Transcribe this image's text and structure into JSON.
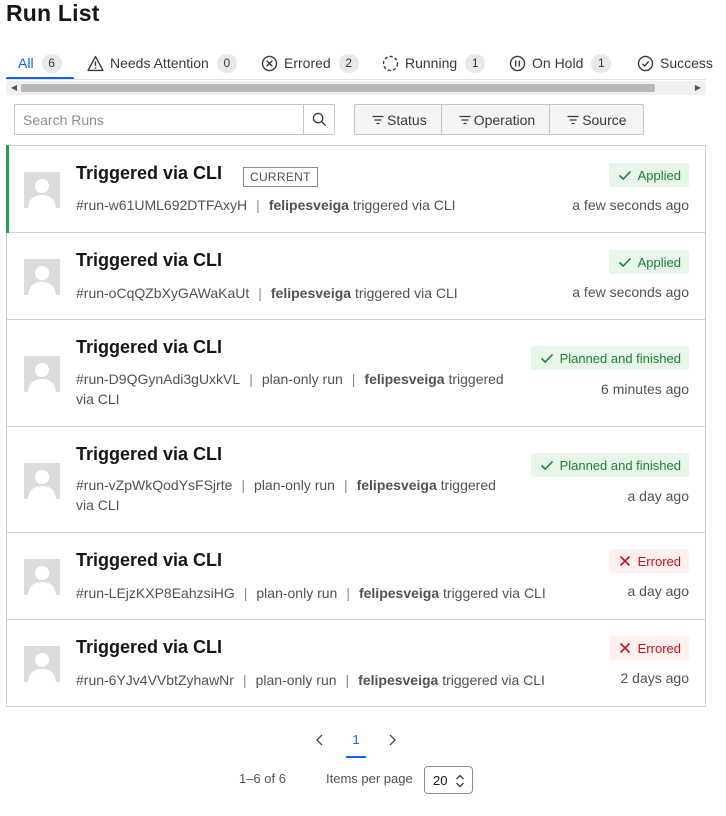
{
  "page": {
    "title": "Run List"
  },
  "tabs": [
    {
      "label": "All",
      "count": "6",
      "icon": "none",
      "active": true
    },
    {
      "label": "Needs Attention",
      "count": "0",
      "icon": "warning-icon"
    },
    {
      "label": "Errored",
      "count": "2",
      "icon": "error-circle-icon"
    },
    {
      "label": "Running",
      "count": "1",
      "icon": "running-icon"
    },
    {
      "label": "On Hold",
      "count": "1",
      "icon": "pause-icon"
    },
    {
      "label": "Success",
      "icon": "check-circle-icon"
    }
  ],
  "toolbar": {
    "search_placeholder": "Search Runs",
    "filters": [
      {
        "label": "Status",
        "icon": "filter-icon"
      },
      {
        "label": "Operation",
        "icon": "filter-icon"
      },
      {
        "label": "Source",
        "icon": "filter-icon"
      }
    ]
  },
  "runs": [
    {
      "title": "Triggered via CLI",
      "current_label": "CURRENT",
      "id": "#run-w61UML692DTFAxyH",
      "user": "felipesveiga",
      "action": "triggered via CLI",
      "status": "Applied",
      "time": "a few seconds ago"
    },
    {
      "title": "Triggered via CLI",
      "id": "#run-oCqQZbXyGAWaKaUt",
      "user": "felipesveiga",
      "action": "triggered via CLI",
      "status": "Applied",
      "time": "a few seconds ago"
    },
    {
      "title": "Triggered via CLI",
      "id": "#run-D9QGynAdi3gUxkVL",
      "type": "plan-only run",
      "user": "felipesveiga",
      "action_line1": "triggered",
      "action_line2": "via CLI",
      "status": "Planned and finished",
      "time": "6 minutes ago"
    },
    {
      "title": "Triggered via CLI",
      "id": "#run-vZpWkQodYsFSjrte",
      "type": "plan-only run",
      "user": "felipesveiga",
      "action_line1": "triggered",
      "action_line2": "via CLI",
      "status": "Planned and finished",
      "time": "a day ago"
    },
    {
      "title": "Triggered via CLI",
      "id": "#run-LEjzKXP8EahzsiHG",
      "type": "plan-only run",
      "user": "felipesveiga",
      "action": "triggered via CLI",
      "status": "Errored",
      "time": "a day ago"
    },
    {
      "title": "Triggered via CLI",
      "id": "#run-6YJv4VVbtZyhawNr",
      "type": "plan-only run",
      "user": "felipesveiga",
      "action": "triggered via CLI",
      "status": "Errored",
      "time": "2 days ago"
    }
  ],
  "pagination": {
    "current_page": "1",
    "range": "1–6 of 6",
    "items_per_page_label": "Items per page",
    "items_per_page": "20"
  },
  "colors": {
    "accent": "#0f62fe",
    "success": "#24a148",
    "error": "#da1e28"
  }
}
